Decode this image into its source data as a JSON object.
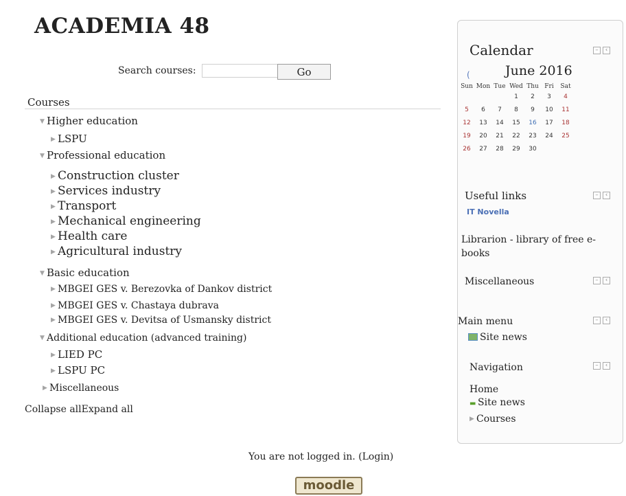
{
  "site": {
    "title": "ACADEMIA 48"
  },
  "search": {
    "label": "Search courses:",
    "value": "",
    "button": "Go"
  },
  "courses": {
    "heading": "Courses",
    "higher": {
      "label": "Higher education",
      "items": [
        "LSPU"
      ]
    },
    "professional": {
      "label": "Professional education",
      "items": [
        "Construction cluster",
        "Services industry",
        "Transport",
        "Mechanical engineering",
        "Health care",
        "Agricultural industry"
      ]
    },
    "basic": {
      "label": "Basic education",
      "items": [
        "MBGEI GES v. Berezovka of Dankov district",
        "MBGEI GES v. Chastaya dubrava",
        "MBGEI GES v. Devitsa of Usmansky district"
      ]
    },
    "additional": {
      "label": "Additional education (advanced training)",
      "items": [
        "LIED PC",
        "LSPU PC"
      ]
    },
    "misc": {
      "label": "Miscellaneous"
    },
    "collapse_all": "Collapse all",
    "expand_all": "Expand all"
  },
  "calendar": {
    "title": "Calendar",
    "month": "June 2016",
    "prev": "(",
    "days": [
      "Sun",
      "Mon",
      "Tue",
      "Wed",
      "Thu",
      "Fri",
      "Sat"
    ],
    "weeks": [
      [
        "",
        "",
        "",
        "1",
        "2",
        "3",
        "4"
      ],
      [
        "5",
        "6",
        "7",
        "8",
        "9",
        "10",
        "11"
      ],
      [
        "12",
        "13",
        "14",
        "15",
        "16",
        "17",
        "18"
      ],
      [
        "19",
        "20",
        "21",
        "22",
        "23",
        "24",
        "25"
      ],
      [
        "26",
        "27",
        "28",
        "29",
        "30",
        "",
        ""
      ]
    ],
    "today": "16",
    "weekend_color": "#a83232",
    "today_color": "#3f6fb4"
  },
  "useful_links": {
    "title": "Useful links",
    "link1": "IT Novella",
    "link2": "Librarion - library of free e-books"
  },
  "miscellaneous": {
    "title": "Miscellaneous"
  },
  "main_menu": {
    "title": "Main menu",
    "site_news": "Site news"
  },
  "navigation": {
    "title": "Navigation",
    "home": "Home",
    "site_news": "Site news",
    "courses": "Courses"
  },
  "footer": {
    "login_text": "You are not logged in. (Login)",
    "logo": "moodle"
  }
}
